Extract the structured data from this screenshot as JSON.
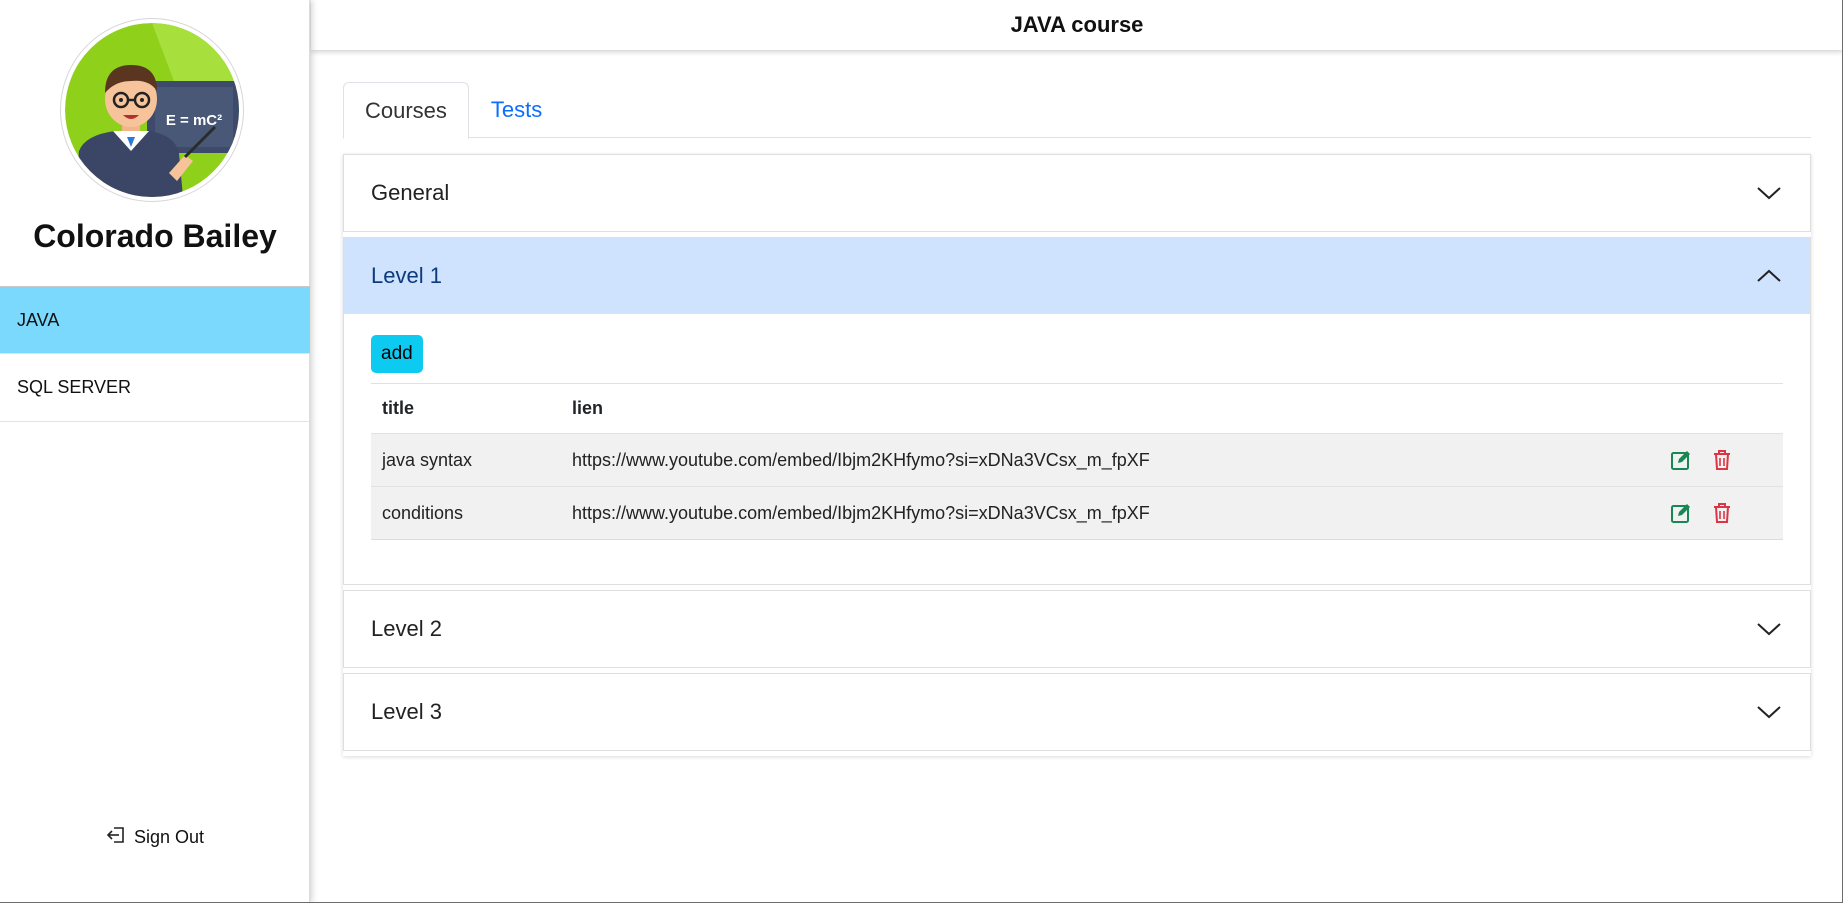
{
  "app": {
    "title": "JAVA course"
  },
  "user": {
    "name": "Colorado Bailey",
    "avatar_board_text": "E = mC²"
  },
  "sidebar": {
    "items": [
      {
        "label": "JAVA",
        "active": true
      },
      {
        "label": "SQL SERVER",
        "active": false
      }
    ],
    "signout_label": "Sign Out"
  },
  "tabs": [
    {
      "label": "Courses",
      "active": true
    },
    {
      "label": "Tests",
      "active": false
    }
  ],
  "accordion": {
    "sections": [
      {
        "label": "General",
        "open": false
      },
      {
        "label": "Level 1",
        "open": true
      },
      {
        "label": "Level 2",
        "open": false
      },
      {
        "label": "Level 3",
        "open": false
      }
    ]
  },
  "level1": {
    "add_label": "add",
    "columns": [
      "title",
      "lien"
    ],
    "rows": [
      {
        "title": "java syntax",
        "lien": "https://www.youtube.com/embed/Ibjm2KHfymo?si=xDNa3VCsx_m_fpXF"
      },
      {
        "title": "conditions",
        "lien": "https://www.youtube.com/embed/Ibjm2KHfymo?si=xDNa3VCsx_m_fpXF"
      }
    ]
  },
  "colors": {
    "sidebar_active": "#7ad9fd",
    "accordion_open": "#cfe2fe",
    "add_button": "#0dcaf0",
    "edit_icon": "#198754",
    "delete_icon": "#dc3545",
    "tab_link": "#0d6efd"
  },
  "icons": {
    "signout": "box-arrow-left-icon",
    "edit": "pencil-square-icon",
    "delete": "trash-icon",
    "chevron_down": "chevron-down-icon",
    "chevron_up": "chevron-up-icon"
  }
}
